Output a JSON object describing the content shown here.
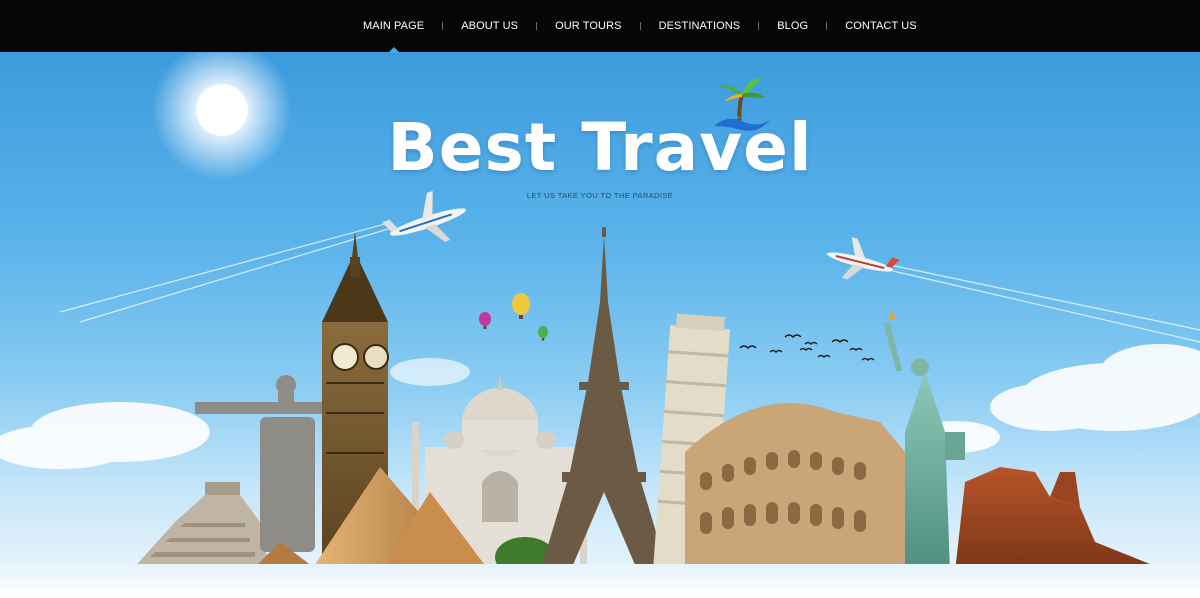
{
  "nav": {
    "items": [
      {
        "label": "MAIN PAGE",
        "active": true
      },
      {
        "label": "ABOUT US",
        "active": false
      },
      {
        "label": "OUR TOURS",
        "active": false
      },
      {
        "label": "DESTINATIONS",
        "active": false
      },
      {
        "label": "BLOG",
        "active": false
      },
      {
        "label": "CONTACT US",
        "active": false
      }
    ]
  },
  "hero": {
    "title": "Best Travel",
    "tagline": "LET US TAKE YOU TO THE PARADISE",
    "logo_icon": "palm-tree-wave-icon"
  },
  "colors": {
    "nav_bg": "#060606",
    "sky_top": "#3d9bdd",
    "sky_bottom": "#f2f8fc",
    "active_marker": "#45a8e6"
  }
}
